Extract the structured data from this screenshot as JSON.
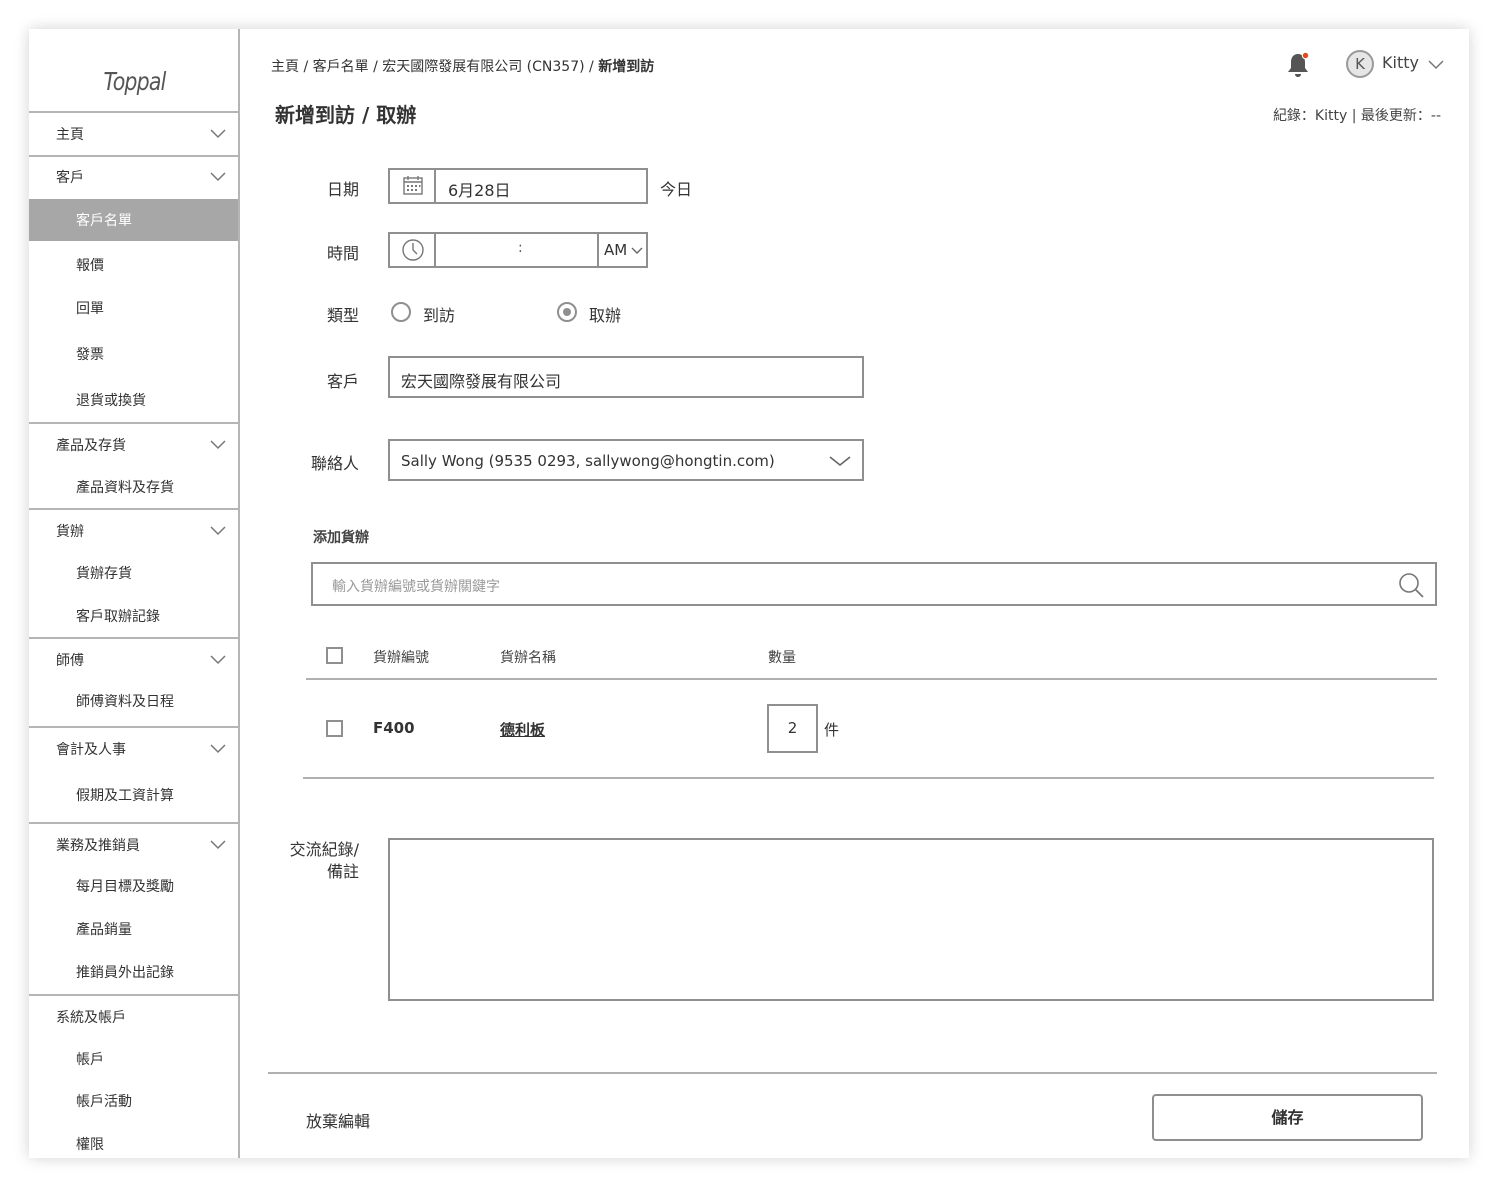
{
  "brand": {
    "logo": "Toppal"
  },
  "sidebar": {
    "sections": [
      {
        "label": "主頁",
        "items": []
      },
      {
        "label": "客戶",
        "items": [
          "客戶名單",
          "報價",
          "回單",
          "發票",
          "退貨或換貨"
        ]
      },
      {
        "label": "產品及存貨",
        "items": [
          "產品資料及存貨"
        ]
      },
      {
        "label": "貨辦",
        "items": [
          "貨辦存貨",
          "客戶取辦記錄"
        ]
      },
      {
        "label": "師傅",
        "items": [
          "師傅資料及日程"
        ]
      },
      {
        "label": "會計及人事",
        "items": [
          "假期及工資計算"
        ]
      },
      {
        "label": "業務及推銷員",
        "items": [
          "每月目標及獎勵",
          "產品銷量",
          "推銷員外出記錄"
        ]
      },
      {
        "label": "系統及帳戶",
        "items": [
          "帳戶",
          "帳戶活動",
          "權限"
        ]
      }
    ],
    "active_item": "客戶名單"
  },
  "header": {
    "breadcrumb": {
      "path": "主頁 / 客戶名單 / 宏天國際發展有限公司 (CN357) / ",
      "current": "新增到訪"
    },
    "user": {
      "initial": "K",
      "name": "Kitty"
    },
    "notification_dot_color": "#e04a1f"
  },
  "page": {
    "title": "新增到訪 / 取辦",
    "meta": "紀錄：Kitty  |  最後更新：--"
  },
  "form": {
    "date": {
      "label": "日期",
      "value": "6月28日",
      "today_label": "今日"
    },
    "time": {
      "label": "時間",
      "separator": ":",
      "ampm": "AM"
    },
    "type": {
      "label": "類型",
      "options": [
        "到訪",
        "取辦"
      ],
      "selected": "取辦"
    },
    "customer": {
      "label": "客戶",
      "value": "宏天國際發展有限公司"
    },
    "contact": {
      "label": "聯絡人",
      "value": "Sally Wong  (9535 0293, sallywong@hongtin.com)"
    },
    "add_goods": {
      "title": "添加貨辦",
      "search_placeholder": "輸入貨辦編號或貨辦關鍵字",
      "columns": [
        "貨辦編號",
        "貨辦名稱",
        "數量"
      ],
      "rows": [
        {
          "code": "F400",
          "name": "德利板",
          "qty": "2",
          "unit": "件"
        }
      ]
    },
    "notes": {
      "label_line1": "交流紀錄/",
      "label_line2": "備註",
      "value": ""
    }
  },
  "footer": {
    "discard_label": "放棄編輯",
    "save_label": "儲存"
  }
}
